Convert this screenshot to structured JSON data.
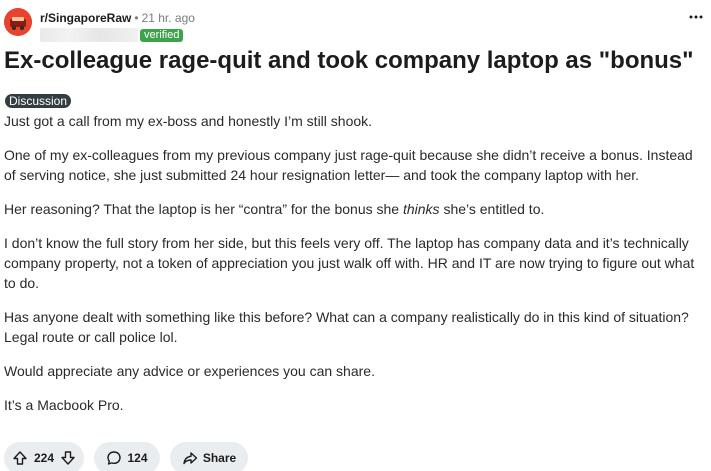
{
  "header": {
    "subreddit": "r/SingaporeRaw",
    "separator": "•",
    "time_ago": "21 hr. ago",
    "verified_label": "verified"
  },
  "post": {
    "title": "Ex-colleague rage-quit and took company laptop as \"bonus\"",
    "flair": "Discussion",
    "paragraphs": {
      "p1": "Just got a call from my ex-boss and honestly I’m still shook.",
      "p2": "One of my ex-colleagues from my previous company just rage-quit because she didn’t receive a bonus. Instead of serving notice, she just submitted 24 hour resignation letter— and took the company laptop with her.",
      "p3_before": "Her reasoning? That the laptop is her “contra” for the bonus she ",
      "p3_em": "thinks",
      "p3_after": " she’s entitled to.",
      "p4": "I don’t know the full story from her side, but this feels very off. The laptop has company data and it’s technically company property, not a token of appreciation you just walk off with. HR and IT are now trying to figure out what to do.",
      "p5": "Has anyone dealt with something like this before? What can a company realistically do in this kind of situation? Legal route or call police lol.",
      "p6": "Would appreciate any advice or experiences you can share.",
      "p7": "It’s a Macbook Pro."
    }
  },
  "actions": {
    "upvotes": "224",
    "comments": "124",
    "share_label": "Share"
  },
  "icons": {
    "upvote": "upvote-arrow-icon",
    "downvote": "downvote-arrow-icon",
    "comment": "comment-bubble-icon",
    "share": "share-arrow-icon",
    "more": "more-dots-icon",
    "subreddit_avatar": "subreddit-avatar"
  },
  "colors": {
    "verified_green": "#3ca34a",
    "flair_bg": "#333d42",
    "pill_bg": "#eaedef",
    "avatar_red": "#e8432f"
  }
}
